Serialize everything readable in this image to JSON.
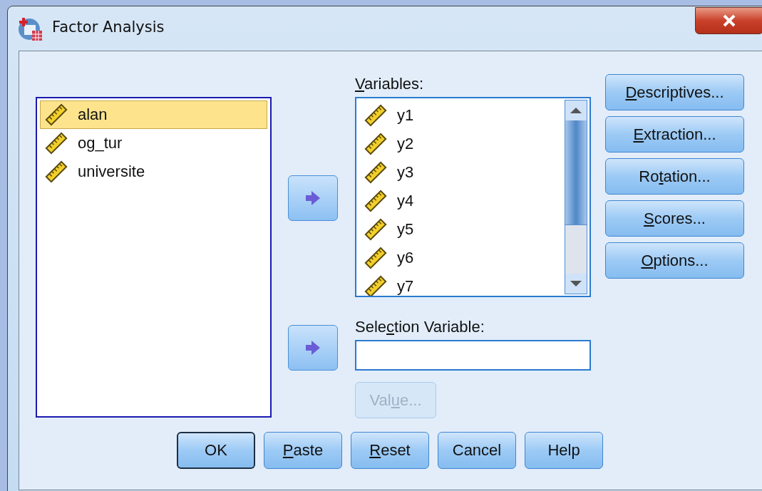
{
  "window": {
    "title": "Factor Analysis"
  },
  "source_list": {
    "items": [
      {
        "name": "alan",
        "selected": true
      },
      {
        "name": "og_tur",
        "selected": false
      },
      {
        "name": "universite",
        "selected": false
      }
    ]
  },
  "variables": {
    "label": {
      "key": "V",
      "post": "ariables:"
    },
    "items": [
      {
        "name": "y1",
        "selected": false
      },
      {
        "name": "y2",
        "selected": false
      },
      {
        "name": "y3",
        "selected": false
      },
      {
        "name": "y4",
        "selected": false
      },
      {
        "name": "y5",
        "selected": false
      },
      {
        "name": "y6",
        "selected": false
      },
      {
        "name": "y7",
        "selected": false
      }
    ]
  },
  "selection_variable": {
    "label": {
      "pre": "Sele",
      "key": "c",
      "post": "tion Variable:"
    },
    "value_button": {
      "label": {
        "pre": "Val",
        "key": "u",
        "post": "e..."
      },
      "disabled": true
    }
  },
  "side_buttons": [
    {
      "label": {
        "key": "D",
        "post": "escriptives..."
      }
    },
    {
      "label": {
        "key": "E",
        "post": "xtraction..."
      }
    },
    {
      "label": {
        "pre": "Ro",
        "key": "t",
        "post": "ation..."
      }
    },
    {
      "label": {
        "key": "S",
        "post": "cores..."
      }
    },
    {
      "label": {
        "key": "O",
        "post": "ptions..."
      }
    }
  ],
  "footer_buttons": [
    {
      "label": {
        "pre": "OK"
      },
      "default": true
    },
    {
      "label": {
        "key": "P",
        "post": "aste"
      },
      "default": false
    },
    {
      "label": {
        "key": "R",
        "post": "eset"
      },
      "default": false
    },
    {
      "label": {
        "pre": "Cancel"
      },
      "default": false
    },
    {
      "label": {
        "pre": "Help"
      },
      "default": false
    }
  ]
}
